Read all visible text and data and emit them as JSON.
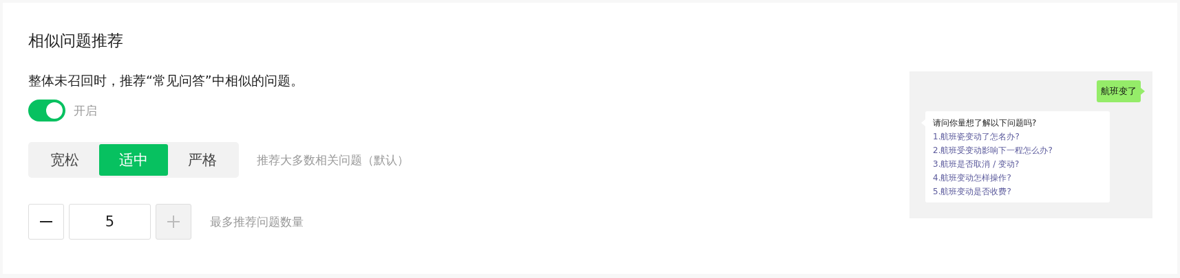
{
  "title": "相似问题推荐",
  "description": "整体未召回时，推荐“常见问答”中相似的问题。",
  "toggle": {
    "on": true,
    "label": "开启"
  },
  "strictness": {
    "options": [
      {
        "label": "宽松",
        "selected": false
      },
      {
        "label": "适中",
        "selected": true
      },
      {
        "label": "严格",
        "selected": false
      }
    ],
    "hint": "推荐大多数相关问题（默认）"
  },
  "stepper": {
    "value": "5",
    "minus_disabled": false,
    "plus_disabled": true,
    "hint": "最多推荐问题数量"
  },
  "preview": {
    "user_message": "航班变了",
    "bot_prompt": "请问你量想了解以下问题吗?",
    "suggestions": [
      "1.航班瓷变动了怎名办?",
      "2.航班受变动影响下一程怎么办?",
      "3.航班是否取消 / 变动?",
      "4.航班变动怎样操作?",
      "5.航班变动是否收费?"
    ]
  }
}
